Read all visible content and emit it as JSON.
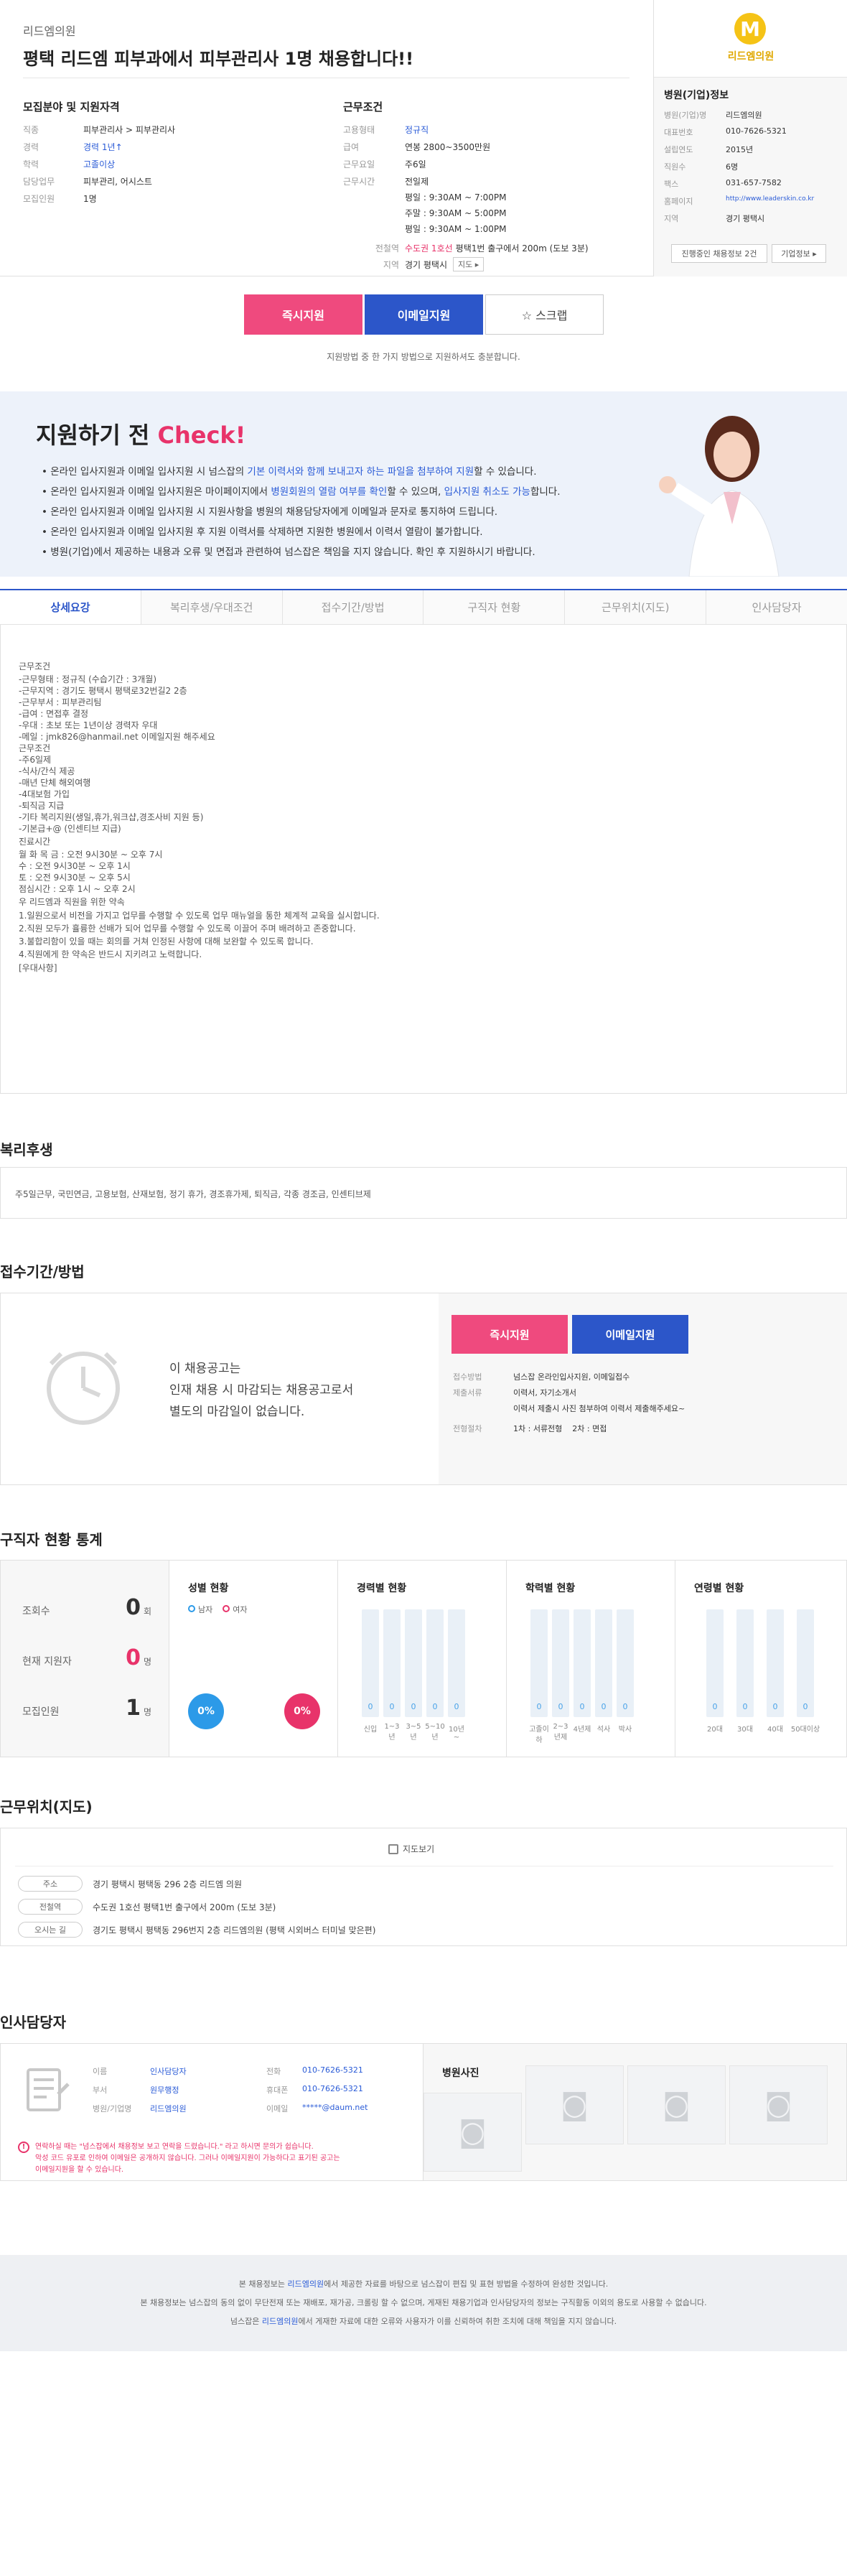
{
  "header": {
    "company": "리드엠의원",
    "title": "평택 리드엠 피부과에서 피부관리사 1명 채용합니다!!"
  },
  "recruit": {
    "heading": "모집분야 및 지원자격",
    "rows": [
      {
        "label": "직종",
        "value": "피부관리사 > 피부관리사"
      },
      {
        "label": "경력",
        "value": "경력 1년↑"
      },
      {
        "label": "학력",
        "value": "고졸이상"
      },
      {
        "label": "담당업무",
        "value": "피부관리, 어시스트"
      },
      {
        "label": "모집인원",
        "value": "1명"
      }
    ]
  },
  "conditions": {
    "heading": "근무조건",
    "type_label": "고용형태",
    "type_value": "정규직",
    "salary_label": "급여",
    "salary_value": "연봉 2800~3500만원",
    "days_label": "근무요일",
    "days_value": "주6일",
    "hours_label": "근무시간",
    "hours": [
      "전일제",
      "평일 : 9:30AM ~ 7:00PM",
      "주말 : 9:30AM ~ 5:00PM",
      "평일 : 9:30AM ~ 1:00PM"
    ],
    "subway_label": "전철역",
    "subway_line": "수도권 1호선",
    "subway_value": "평택1번 출구에서 200m (도보 3분)",
    "region_label": "지역",
    "region_value": "경기 평택시",
    "map_btn": "지도 ▸"
  },
  "company": {
    "logo_letter": "M",
    "logo_text": "리드엠의원",
    "heading": "병원(기업)정보",
    "rows": [
      {
        "label": "병원(기업)명",
        "value": "리드엠의원"
      },
      {
        "label": "대표번호",
        "value": "010-7626-5321"
      },
      {
        "label": "설립연도",
        "value": "2015년"
      },
      {
        "label": "직원수",
        "value": "6명"
      },
      {
        "label": "팩스",
        "value": "031-657-7582"
      },
      {
        "label": "홈페이지",
        "value": "http://www.leaderskin.co.kr"
      },
      {
        "label": "지역",
        "value": "경기 평택시"
      }
    ],
    "btn_jobs": "진행중인 채용정보 2건",
    "btn_info": "기업정보 ▸"
  },
  "apply": {
    "instant": "즉시지원",
    "email": "이메일지원",
    "scrap": "☆ 스크랩",
    "note": "지원방법 중 한 가지 방법으로 지원하셔도 충분합니다."
  },
  "check": {
    "title_a": "지원하기 전 ",
    "title_b": "Check!",
    "items": [
      {
        "a": "온라인 입사지원과 이메일 입사지원 시 넘스잡의 ",
        "b": "기본 이력서와 함께 보내고자 하는 파일을 첨부하여 지원",
        "c": "할 수 있습니다."
      },
      {
        "a": "온라인 입사지원과 이메일 입사지원은 마이페이지에서 ",
        "b": "병원회원의 열람 여부를 확인",
        "c": "할 수 있으며, ",
        "d": "입사지원 취소도 가능",
        "e": "합니다."
      },
      {
        "a": "온라인 입사지원과 이메일 입사지원 시 지원사항을 병원의 채용담당자에게 이메일과 문자로 통지하여 드립니다."
      },
      {
        "a": "온라인 입사지원과 이메일 입사지원 후 지원 이력서를 삭제하면 지원한 병원에서 이력서 열람이 불가합니다."
      },
      {
        "a": "병원(기업)에서 제공하는 내용과 오류 및 면접과 관련하여 넘스잡은 책임을 지지 않습니다. 확인 후 지원하시기 바랍니다."
      }
    ]
  },
  "tabs": [
    "상세요강",
    "복리후생/우대조건",
    "접수기간/방법",
    "구직자 현황",
    "근무위치(지도)",
    "인사담당자"
  ],
  "detail": {
    "lines": [
      "근무조건",
      "",
      "-근무형태 : 정규직 (수습기간 : 3개월)",
      "-근무지역 : 경기도 평택시 평택로32번길2 2층",
      "-근무부서 : 피부관리팀",
      "-급여 : 면접후 결정",
      "-우대 : 초보 또는 1년이상 경력자 우대",
      "-메일 : jmk826@hanmail.net 이메일지원 해주세요",
      "근무조건",
      "",
      "-주6일제",
      "-식사/간식 제공",
      "-매년 단체 해외여행",
      "-4대보험 가입",
      "-퇴직금 지급",
      "-기타 복리지원(생일,휴가,워크샵,경조사비 지원 등)",
      "-기본급+@ (인센티브 지급)",
      "",
      "진료시간",
      "",
      "월 화 목 금 : 오전 9시30분 ~ 오후 7시",
      "수 : 오전 9시30분 ~ 오후 1시",
      "토 : 오전 9시30분 ~ 오후 5시",
      "점심시간 : 오후 1시 ~ 오후 2시",
      "",
      "우 리드엠과 직원을 위한 약속",
      "",
      "1.일원으로서 비전을 가지고 업무를 수행할 수 있도록 업무 매뉴얼을 통한 체계적 교육을 실시합니다.",
      "2.직원 모두가 휼륭한 선배가 되어 업무를 수행할 수 있도록 이끌어 주며 배려하고 존중합니다.",
      "3.불합리함이 있을 때는 회의를 거쳐 인정된 사항에 대해 보완할 수 있도록 합니다.",
      "4.직원에게 한 약속은 반드시 지키려고 노력합니다.",
      "",
      "[우대사항]"
    ]
  },
  "welfare": {
    "title": "복리후생",
    "text": "주5일근무, 국민연금, 고용보험, 산재보험, 정기 휴가, 경조휴가제, 퇴직금, 각종 경조금, 인센티브제"
  },
  "period": {
    "title": "접수기간/방법",
    "closed": [
      "이 채용공고는",
      "인재 채용 시 마감되는 채용공고로서",
      "별도의 마감일이 없습니다."
    ],
    "instant": "즉시지원",
    "email": "이메일지원",
    "method_label": "접수방법",
    "method_value": "넘스잡 온라인입사지원, 이메일접수",
    "docs_label": "제출서류",
    "docs_value": [
      "이력서, 자기소개서",
      "이력서 제출시 사진 첨부하여 이력서 제출해주세요~"
    ],
    "process_label": "전형절차",
    "process_value": "1차 : 서류전형    2차 : 면접"
  },
  "stats": {
    "title": "구직자 현황 통계",
    "views_label": "조회수",
    "views": "0",
    "views_unit": "회",
    "applicants_label": "현재 지원자",
    "applicants": "0",
    "applicants_unit": "명",
    "recruit_label": "모집인원",
    "recruit": "1",
    "recruit_unit": "명",
    "gender_title": "성별 현황",
    "male": "남자",
    "female": "여자",
    "male_pct": "0%",
    "female_pct": "0%",
    "career_title": "경력별 현황",
    "career_bars": [
      {
        "label": "신입",
        "v": "0"
      },
      {
        "label": "1~3년",
        "v": "0"
      },
      {
        "label": "3~5년",
        "v": "0"
      },
      {
        "label": "5~10년",
        "v": "0"
      },
      {
        "label": "10년~",
        "v": "0"
      }
    ],
    "edu_title": "학력별 현황",
    "edu_bars": [
      {
        "label": "고졸이하",
        "v": "0"
      },
      {
        "label": "2~3년제",
        "v": "0"
      },
      {
        "label": "4년제",
        "v": "0"
      },
      {
        "label": "석사",
        "v": "0"
      },
      {
        "label": "박사",
        "v": "0"
      }
    ],
    "age_title": "연령별 현황",
    "age_bars": [
      {
        "label": "20대",
        "v": "0"
      },
      {
        "label": "30대",
        "v": "0"
      },
      {
        "label": "40대",
        "v": "0"
      },
      {
        "label": "50대이상",
        "v": "0"
      }
    ]
  },
  "location": {
    "title": "근무위치(지도)",
    "map_btn": "지도보기",
    "addr_label": "주소",
    "addr": "경기 평택시 평택동 296 2층 리드엠 의원",
    "subway_label": "전철역",
    "subway": "수도권 1호선 평택1번 출구에서 200m (도보 3분)",
    "dir_label": "오시는 길",
    "dir": "경기도 평택시 평택동 296번지 2층 리드엠의원 (평택 시외버스 터미널 맞은편)"
  },
  "hr": {
    "title": "인사담당자",
    "name_label": "이름",
    "name": "인사담당자",
    "dept_label": "부서",
    "dept": "원무행정",
    "org_label": "병원/기업명",
    "org": "리드엠의원",
    "tel_label": "전화",
    "tel": "010-7626-5321",
    "mobile_label": "휴대폰",
    "mobile": "010-7626-5321",
    "mail_label": "이메일",
    "mail": "*****@daum.net",
    "warn": [
      "연락하실 때는 \"넘스잡에서 채용정보 보고 연락을 드렸습니다.\" 라고 하시면 문의가 쉽습니다.",
      "악성 코드 유포로 인하여 이메일은 공개하지 않습니다. 그러나 이메일지원이 가능하다고 표기된 공고는",
      "이메일지원을 할 수 있습니다."
    ],
    "photos_title": "병원사진"
  },
  "footer": {
    "lines": [
      [
        "본 채용정보는 ",
        "리드엠의원",
        "에서 제공한 자료를 바탕으로 넘스잡이 편집 및 표현 방법을 수정하여 완성한 것입니다."
      ],
      [
        "본 채용정보는 넘스잡의 동의 없이 무단전재 또는 재배포, 재가공, 크롤링 할 수 없으며, 게재된 채용기업과 인사담당자의 정보는 구직활동 이외의 용도로 사용할 수 없습니다."
      ],
      [
        "넘스잡은 ",
        "리드엠의원",
        "에서 게재한 자료에 대한 오류와 사용자가 이를 신뢰하여 취한 조치에 대해 책임을 지지 않습니다."
      ]
    ]
  },
  "colors": {
    "pink": "#ef4a7e",
    "blue": "#2c56c9",
    "accent": "#e8336a"
  }
}
